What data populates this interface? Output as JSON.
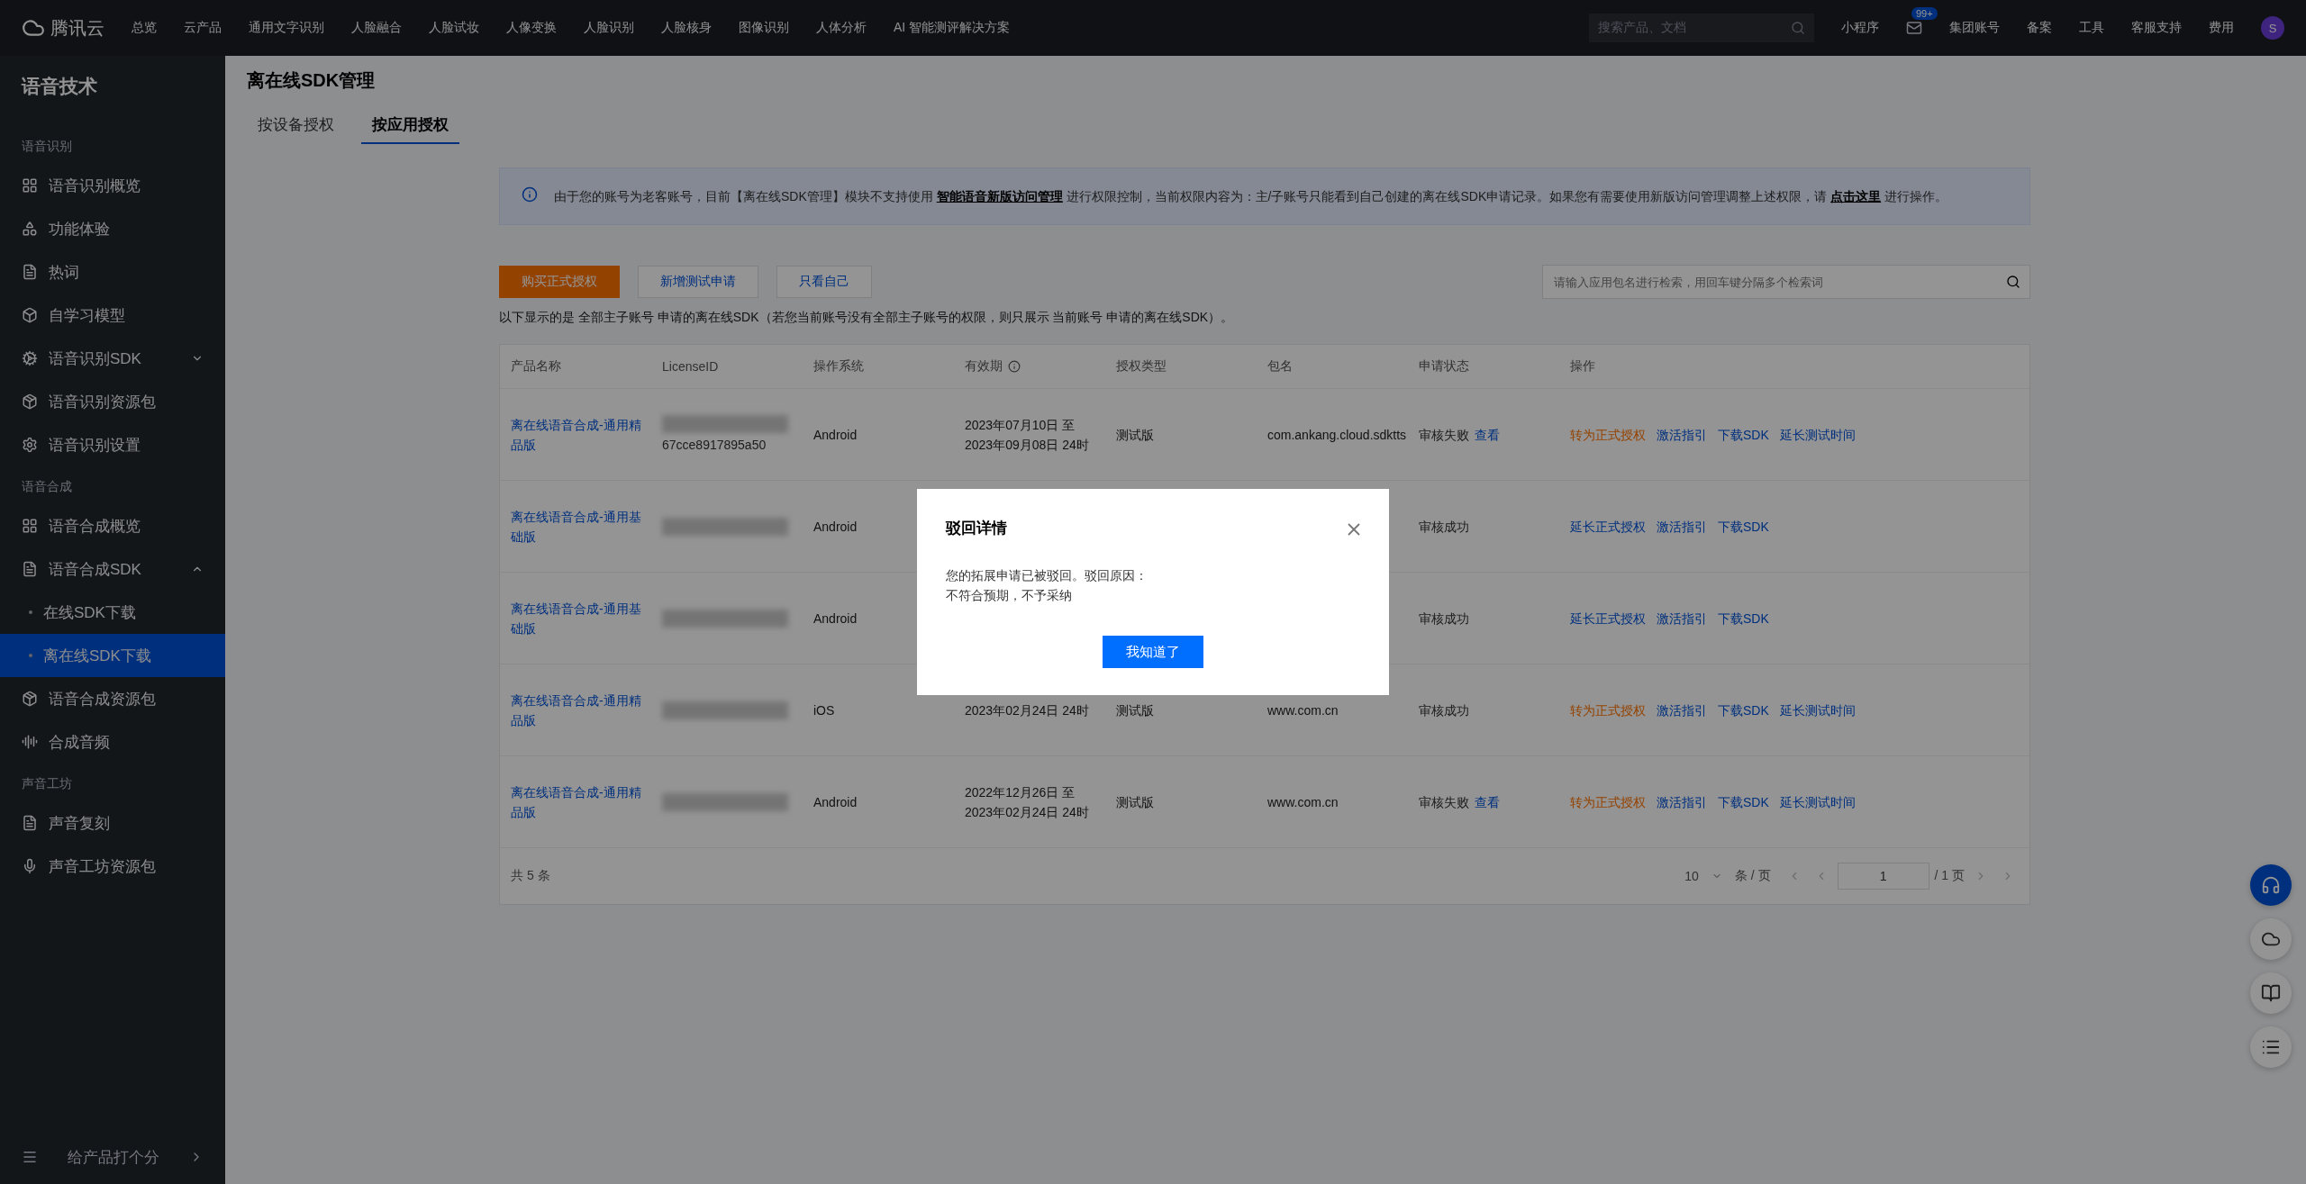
{
  "top_bar": {
    "logo": "腾讯云",
    "nav": [
      "总览",
      "云产品",
      "通用文字识别",
      "人脸融合",
      "人脸试妆",
      "人像变换",
      "人脸识别",
      "人脸核身",
      "图像识别",
      "人体分析",
      "AI 智能测评解决方案"
    ],
    "search": {
      "placeholder": "搜索产品、文档"
    },
    "mini_program": "小程序",
    "mail_badge": "99+",
    "account": "集团账号",
    "links": [
      "备案",
      "工具",
      "客服支持",
      "费用"
    ],
    "avatar": "S"
  },
  "sidebar": {
    "title": "语音技术",
    "sections": [
      {
        "label": "语音识别",
        "items": [
          {
            "label": "语音识别概览"
          },
          {
            "label": "功能体验"
          },
          {
            "label": "热词"
          },
          {
            "label": "自学习模型"
          },
          {
            "label": "语音识别SDK",
            "expanded": false
          },
          {
            "label": "语音识别资源包"
          },
          {
            "label": "语音识别设置"
          }
        ]
      },
      {
        "label": "语音合成",
        "items": [
          {
            "label": "语音合成概览"
          },
          {
            "label": "语音合成SDK",
            "expanded": true,
            "children": [
              {
                "label": "在线SDK下载",
                "selected": false
              },
              {
                "label": "离在线SDK下载",
                "selected": true
              }
            ]
          },
          {
            "label": "语音合成资源包"
          },
          {
            "label": "合成音频"
          }
        ]
      },
      {
        "label": "声音工坊",
        "items": [
          {
            "label": "声音复刻"
          },
          {
            "label": "声音工坊资源包"
          }
        ]
      }
    ],
    "feedback": "给产品打个分"
  },
  "page": {
    "title": "离在线SDK管理",
    "tabs": [
      {
        "label": "按设备授权",
        "selected": false
      },
      {
        "label": "按应用授权",
        "selected": true
      }
    ],
    "notice": {
      "before": "由于您的账号为老客账号，目前【离在线SDK管理】模块不支持使用",
      "link1": "智能语音新版访问管理",
      "middle": "进行权限控制，当前权限内容为：主/子账号只能看到自己创建的离在线SDK申请记录。如果您有需要使用新版访问管理调整上述权限，请",
      "link2": "点击这里",
      "after": "进行操作。"
    },
    "buttons": [
      {
        "label": "购买正式授权",
        "kind": "primary"
      },
      {
        "label": "新增测试申请",
        "kind": "default"
      },
      {
        "label": "只看自己",
        "kind": "default"
      }
    ],
    "search": {
      "placeholder": "请输入应用包名进行检索，用回车键分隔多个检索词"
    },
    "hint": "以下显示的是 全部主子账号 申请的离在线SDK（若您当前账号没有全部主子账号的权限，则只展示 当前账号 申请的离在线SDK）。",
    "table": {
      "columns": [
        "产品名称",
        "LicenseID",
        "操作系统",
        "有效期",
        "授权类型",
        "包名",
        "申请状态",
        "操作"
      ],
      "rows": [
        {
          "product": "离在线语音合成-通用精品版",
          "license": "67cce8917895a50",
          "os": "Android",
          "validity": "2023年07月10日 至 2023年09月08日 24时",
          "type": "测试版",
          "package": "com.ankang.cloud.sdktts",
          "status": "审核失败",
          "status_link": "查看",
          "actions": [
            {
              "label": "转为正式授权",
              "kind": "warn"
            },
            {
              "label": "激活指引",
              "kind": "link"
            },
            {
              "label": "下载SDK",
              "kind": "link"
            },
            {
              "label": "延长测试时间",
              "kind": "link"
            }
          ]
        },
        {
          "product": "离在线语音合成-通用基础版",
          "os": "Android",
          "status": "审核成功",
          "actions": [
            {
              "label": "延长正式授权",
              "kind": "link"
            },
            {
              "label": "激活指引",
              "kind": "link"
            },
            {
              "label": "下载SDK",
              "kind": "link"
            }
          ]
        },
        {
          "product": "离在线语音合成-通用基础版",
          "os": "Android",
          "status": "审核成功",
          "actions": [
            {
              "label": "延长正式授权",
              "kind": "link"
            },
            {
              "label": "激活指引",
              "kind": "link"
            },
            {
              "label": "下载SDK",
              "kind": "link"
            }
          ]
        },
        {
          "product": "离在线语音合成-通用精品版",
          "os": "iOS",
          "validity": "2023年02月24日 24时",
          "type": "测试版",
          "package": "www.com.cn",
          "status": "审核成功",
          "actions": [
            {
              "label": "转为正式授权",
              "kind": "warn"
            },
            {
              "label": "激活指引",
              "kind": "link"
            },
            {
              "label": "下载SDK",
              "kind": "link"
            },
            {
              "label": "延长测试时间",
              "kind": "link"
            }
          ]
        },
        {
          "product": "离在线语音合成-通用精品版",
          "os": "Android",
          "validity": "2022年12月26日 至 2023年02月24日 24时",
          "type": "测试版",
          "package": "www.com.cn",
          "status": "审核失败",
          "status_link": "查看",
          "actions": [
            {
              "label": "转为正式授权",
              "kind": "warn"
            },
            {
              "label": "激活指引",
              "kind": "link"
            },
            {
              "label": "下载SDK",
              "kind": "link"
            },
            {
              "label": "延长测试时间",
              "kind": "link"
            }
          ]
        }
      ]
    },
    "pagination": {
      "total": "共 5 条",
      "page_size": "10",
      "page_size_unit": "条 / 页",
      "page": "1",
      "pages": "/ 1 页"
    }
  },
  "dialog": {
    "title": "驳回详情",
    "lines": [
      "您的拓展申请已被驳回。驳回原因：",
      "不符合预期，不予采纳"
    ],
    "button": "我知道了"
  }
}
